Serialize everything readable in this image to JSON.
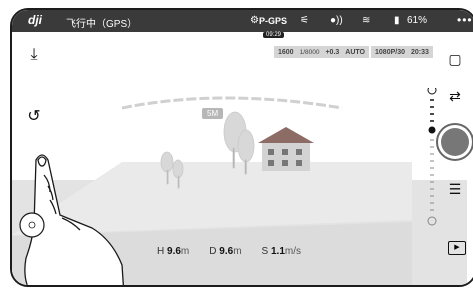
{
  "topbar": {
    "logo": "dji",
    "status": "飞行中（GPS）",
    "flight_mode": "P-GPS",
    "battery": "61%",
    "more": "•••"
  },
  "flight_time": "09:29",
  "camera": {
    "iso_value": "1600",
    "shutter_value": "1/8000",
    "ev_value": "+0.3",
    "wb_value": "AUTO",
    "resolution": "1080P/30",
    "record_time": "20:33"
  },
  "distance_marker": "5M",
  "telemetry": {
    "h_label": "H",
    "h_value": "9.6",
    "h_unit": "m",
    "d_label": "D",
    "d_value": "9.6",
    "d_unit": "m",
    "s_label": "S",
    "s_value": "1.1",
    "s_unit": "m/s"
  },
  "icons": {
    "takeoff": "takeoff-icon",
    "return_home": "return-home-icon",
    "camera_switch": "camera-switch-icon",
    "mode_toggle": "video-photo-toggle-icon",
    "settings": "camera-settings-icon",
    "playback": "playback-icon"
  },
  "colors": {
    "topbar": "#3a3a3a",
    "ground": "#e1e1e1",
    "shutter": "#777777"
  }
}
